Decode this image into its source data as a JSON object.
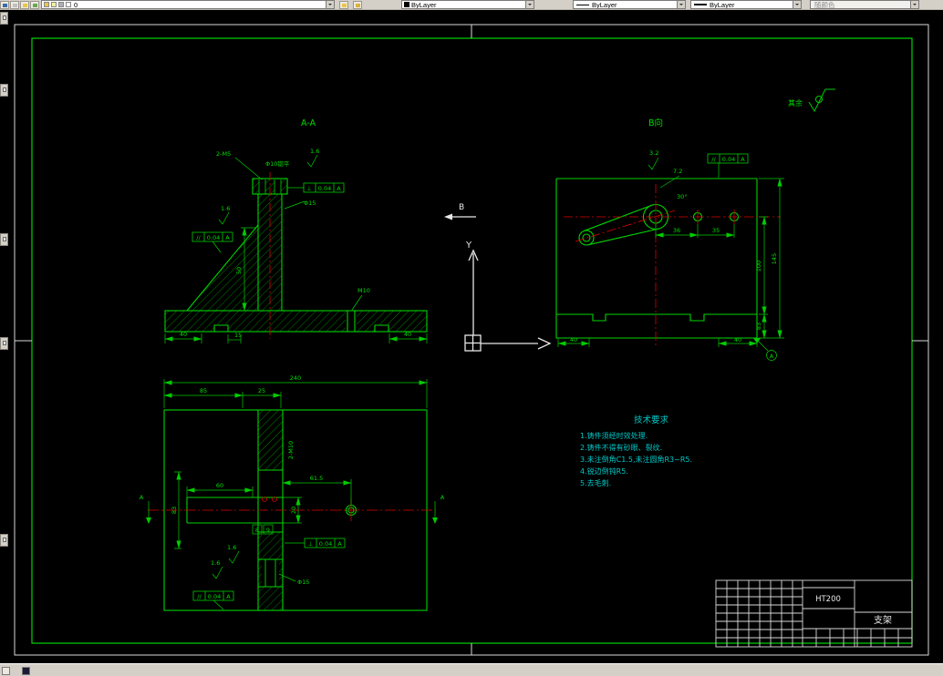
{
  "toolbar": {
    "layer_value": "0",
    "color_value": "ByLayer",
    "linetype_value": "ByLayer",
    "lineweight_value": "ByLayer",
    "plot_style_value": "随颜色"
  },
  "sheet": {
    "background": "#000000",
    "line_color": "#00d400",
    "centerline_color": "#dd0000",
    "dim_text_color": "#00dd00"
  },
  "aa_view": {
    "label": "A-A",
    "dim_40_left": "40",
    "dim_40_right": "40",
    "dim_15": "15",
    "dim_50": "50",
    "label_holes": "2-M5",
    "label_cbore": "Φ10锪平",
    "label_phi15": "Φ15",
    "label_m10": "M10",
    "surface_1": "1.6",
    "surface_2": "1.6",
    "tol_perp": {
      "sym": "⊥",
      "val": "0.04",
      "datum": "A"
    },
    "tol_par": {
      "sym": "//",
      "val": "0.04",
      "datum": "A"
    }
  },
  "b_view": {
    "label": "B向",
    "dim_7_2": "7.2",
    "surface_3_2": "3.2",
    "angle_30": "30°",
    "dim_36": "36",
    "dim_35": "35",
    "dim_100": "100",
    "dim_145": "145",
    "dim_83": "83",
    "dim_40_left": "40",
    "dim_40_right": "40",
    "datum_label": "A",
    "tol_par": {
      "sym": "//",
      "val": "0.04",
      "datum": "A"
    }
  },
  "plan_view": {
    "dim_240": "240",
    "dim_85": "85",
    "dim_25": "25",
    "dim_60": "60",
    "dim_61_5": "61.5",
    "dim_20": "20",
    "dim_83": "83",
    "box_8": "8",
    "box_9": "9",
    "label_2m10": "2-M10",
    "label_phi15": "Φ15",
    "surface_1": "1.6",
    "surface_2": "1.6",
    "section_a_left": "A",
    "section_a_right": "A",
    "tol_perp": {
      "sym": "⊥",
      "val": "0.04",
      "datum": "A"
    },
    "tol_par": {
      "sym": "//",
      "val": "0.04",
      "datum": "A"
    }
  },
  "ucs": {
    "y_label": "Y"
  },
  "view_arrow": {
    "label": "B"
  },
  "finish_note": {
    "label": "其余"
  },
  "tech_requirements": {
    "title": "技术要求",
    "items": [
      "1.铸件须经时效处理.",
      "2.铸件不得有砂眼、裂纹.",
      "3.未注倒角C1.5,未注圆角R3~R5.",
      "4.锐边倒钝R5.",
      "5.去毛刺."
    ]
  },
  "title_block": {
    "material": "HT200",
    "part_name": "支架"
  }
}
